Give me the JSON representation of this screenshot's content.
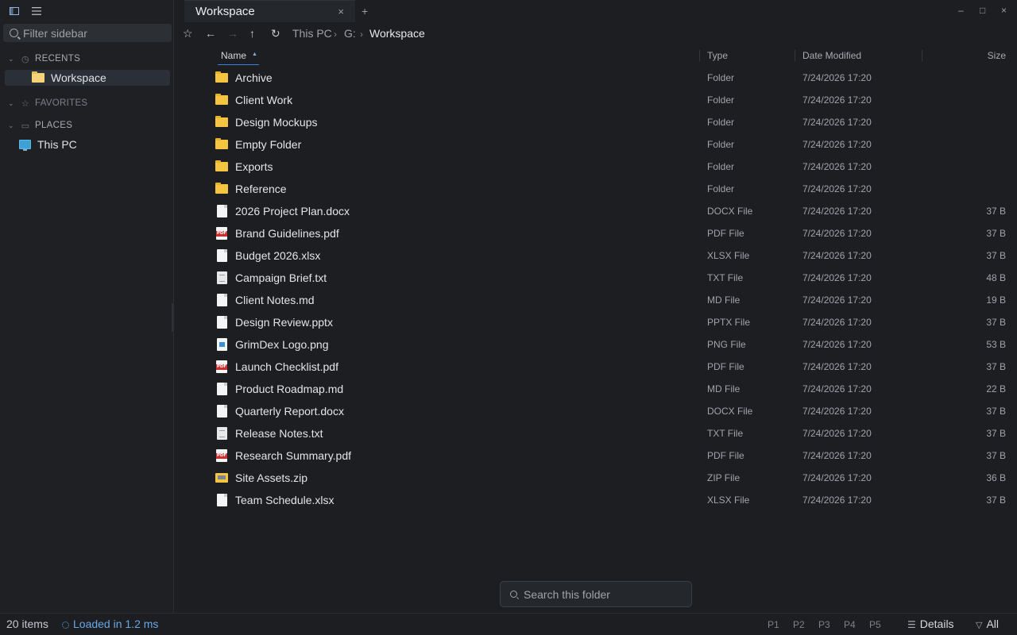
{
  "sidebar": {
    "filter_placeholder": "Filter sidebar",
    "sections": {
      "recents": {
        "label": "RECENTS",
        "items": [
          {
            "label": "Workspace"
          }
        ]
      },
      "favorites": {
        "label": "FAVORITES"
      },
      "places": {
        "label": "PLACES",
        "items": [
          {
            "label": "This PC"
          }
        ]
      }
    }
  },
  "tabs": [
    {
      "label": "Workspace",
      "close": "×"
    }
  ],
  "new_tab": "+",
  "window": {
    "minimize": "–",
    "maximize": "□",
    "close": "×"
  },
  "breadcrumb": {
    "root": "This PC",
    "drive": "G:",
    "current": "Workspace",
    "sep": "›"
  },
  "columns": {
    "name": "Name",
    "type": "Type",
    "date": "Date Modified",
    "size": "Size"
  },
  "rows": [
    {
      "name": "Archive",
      "kind": "folder",
      "type": "Folder",
      "date": "7/24/2026 17:20",
      "size": ""
    },
    {
      "name": "Client Work",
      "kind": "folder",
      "type": "Folder",
      "date": "7/24/2026 17:20",
      "size": ""
    },
    {
      "name": "Design Mockups",
      "kind": "folder",
      "type": "Folder",
      "date": "7/24/2026 17:20",
      "size": ""
    },
    {
      "name": "Empty Folder",
      "kind": "folder",
      "type": "Folder",
      "date": "7/24/2026 17:20",
      "size": ""
    },
    {
      "name": "Exports",
      "kind": "folder",
      "type": "Folder",
      "date": "7/24/2026 17:20",
      "size": ""
    },
    {
      "name": "Reference",
      "kind": "folder",
      "type": "Folder",
      "date": "7/24/2026 17:20",
      "size": ""
    },
    {
      "name": "2026 Project Plan.docx",
      "kind": "doc",
      "type": "DOCX File",
      "date": "7/24/2026 17:20",
      "size": "37 B"
    },
    {
      "name": "Brand Guidelines.pdf",
      "kind": "pdf",
      "type": "PDF File",
      "date": "7/24/2026 17:20",
      "size": "37 B"
    },
    {
      "name": "Budget 2026.xlsx",
      "kind": "doc",
      "type": "XLSX File",
      "date": "7/24/2026 17:20",
      "size": "37 B"
    },
    {
      "name": "Campaign Brief.txt",
      "kind": "txt",
      "type": "TXT File",
      "date": "7/24/2026 17:20",
      "size": "48 B"
    },
    {
      "name": "Client Notes.md",
      "kind": "doc",
      "type": "MD File",
      "date": "7/24/2026 17:20",
      "size": "19 B"
    },
    {
      "name": "Design Review.pptx",
      "kind": "doc",
      "type": "PPTX File",
      "date": "7/24/2026 17:20",
      "size": "37 B"
    },
    {
      "name": "GrimDex Logo.png",
      "kind": "png",
      "type": "PNG File",
      "date": "7/24/2026 17:20",
      "size": "53 B"
    },
    {
      "name": "Launch Checklist.pdf",
      "kind": "pdf",
      "type": "PDF File",
      "date": "7/24/2026 17:20",
      "size": "37 B"
    },
    {
      "name": "Product Roadmap.md",
      "kind": "doc",
      "type": "MD File",
      "date": "7/24/2026 17:20",
      "size": "22 B"
    },
    {
      "name": "Quarterly Report.docx",
      "kind": "doc",
      "type": "DOCX File",
      "date": "7/24/2026 17:20",
      "size": "37 B"
    },
    {
      "name": "Release Notes.txt",
      "kind": "txt",
      "type": "TXT File",
      "date": "7/24/2026 17:20",
      "size": "37 B"
    },
    {
      "name": "Research Summary.pdf",
      "kind": "pdf",
      "type": "PDF File",
      "date": "7/24/2026 17:20",
      "size": "37 B"
    },
    {
      "name": "Site Assets.zip",
      "kind": "zip",
      "type": "ZIP File",
      "date": "7/24/2026 17:20",
      "size": "36 B"
    },
    {
      "name": "Team Schedule.xlsx",
      "kind": "doc",
      "type": "XLSX File",
      "date": "7/24/2026 17:20",
      "size": "37 B"
    }
  ],
  "search_placeholder": "Search this folder",
  "status": {
    "count": "20 items",
    "loaded": "Loaded in 1.2 ms",
    "panes": [
      "P1",
      "P2",
      "P3",
      "P4",
      "P5"
    ],
    "view": "Details",
    "filter": "All"
  },
  "icons": {
    "sidebar_toggle": "sidebar-toggle-icon",
    "menu": "menu-icon",
    "star": "star-icon",
    "back": "back-arrow-icon",
    "forward": "forward-arrow-icon",
    "up": "up-arrow-icon",
    "refresh": "refresh-icon"
  },
  "colors": {
    "accent": "#3b82d6",
    "folder": "#f5c542",
    "pdf": "#c9302c",
    "background": "#1c1e22"
  }
}
